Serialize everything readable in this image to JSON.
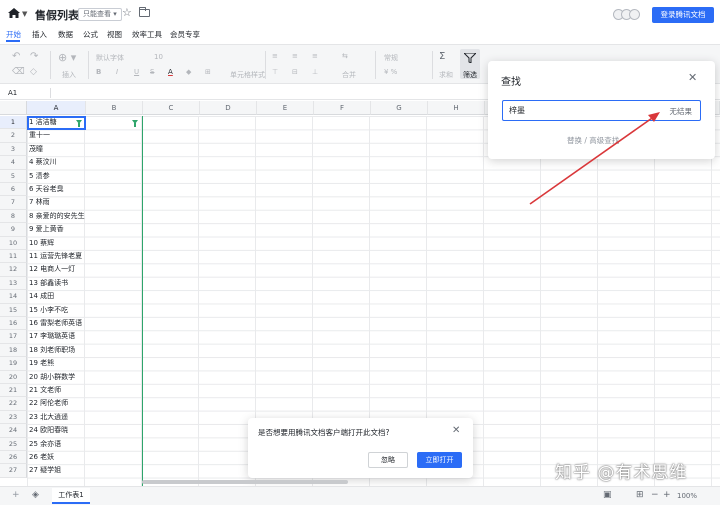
{
  "window": {
    "title": "售假列表",
    "mode_badge": "只能查看 ▾",
    "login_button": "登录腾讯文档"
  },
  "menu": {
    "tabs": [
      "开始",
      "插入",
      "数据",
      "公式",
      "视图",
      "效率工具",
      "会员专享"
    ],
    "active_index": 0
  },
  "toolbar": {
    "insert": "插入",
    "font": "默认字体",
    "font_size": "10",
    "cell_style": "单元格样式",
    "merge": "合并",
    "format": "常规",
    "sum": "求和",
    "filter_label": "筛选",
    "filter_icon": "funnel-icon"
  },
  "formula": {
    "cell_ref": "A1"
  },
  "columns": [
    "A",
    "B",
    "C",
    "D",
    "E",
    "F",
    "G",
    "H"
  ],
  "rows": [
    {
      "num": "1",
      "a": "1 洁洁糖"
    },
    {
      "num": "2",
      "a": "  重十一"
    },
    {
      "num": "3",
      "a": "茂瞳"
    },
    {
      "num": "4",
      "a": "4 蔡汶川"
    },
    {
      "num": "5",
      "a": "5 渍参"
    },
    {
      "num": "6",
      "a": "6  天谷老臭"
    },
    {
      "num": "7",
      "a": "7 林雨"
    },
    {
      "num": "8",
      "a": "8  亲爱的的安先生"
    },
    {
      "num": "9",
      "a": "9    爱上黄香"
    },
    {
      "num": "10",
      "a": "10    蔡辉"
    },
    {
      "num": "11",
      "a": "11    运营先锋老夏"
    },
    {
      "num": "12",
      "a": "12    电商人一灯"
    },
    {
      "num": "13",
      "a": "13 部鑫读书"
    },
    {
      "num": "14",
      "a": "14 成田"
    },
    {
      "num": "15",
      "a": "15 小李不吃"
    },
    {
      "num": "16",
      "a": "16 雷梨老师英语"
    },
    {
      "num": "17",
      "a": "17 李璐璐英语"
    },
    {
      "num": "18",
      "a": "18 刘老师职场"
    },
    {
      "num": "19",
      "a": "19 老熊"
    },
    {
      "num": "20",
      "a": "20  胡小群数学"
    },
    {
      "num": "21",
      "a": "21 文老师"
    },
    {
      "num": "22",
      "a": "22 阿伦老师"
    },
    {
      "num": "23",
      "a": "23 北大逍遥"
    },
    {
      "num": "24",
      "a": "24 欧阳春晓"
    },
    {
      "num": "25",
      "a": "25 余亦语"
    },
    {
      "num": "26",
      "a": "26 老妖"
    },
    {
      "num": "27",
      "a": "27 疑学姐"
    }
  ],
  "find_panel": {
    "title": "查找",
    "query": "梓墨",
    "result": "无结果",
    "links": "替换 / 高级查找"
  },
  "dialog": {
    "message": "是否想要用腾讯文档客户端打开此文档?",
    "ignore": "忽略",
    "open": "立即打开"
  },
  "sheet": {
    "tab_name": "工作表1",
    "zoom": "100%"
  },
  "watermark": "知乎 @有术思维",
  "colors": {
    "accent": "#2b6cf6",
    "filter_green": "#2fa56b",
    "arrow_red": "#d9373a"
  }
}
